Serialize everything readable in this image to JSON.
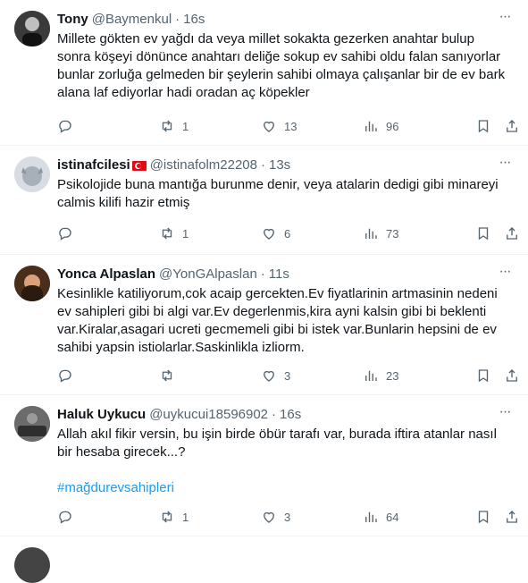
{
  "tweets": [
    {
      "name": "Tony",
      "handle": "@Baymenkul",
      "dot": "·",
      "time": "16s",
      "text": "Millete gökten ev yağdı da veya millet sokakta gezerken anahtar bulup\nsonra köşeyi dönünce anahtarı deliğe sokup ev sahibi oldu falan sanıyorlar\nbunlar zorluğa gelmeden bir şeylerin sahibi olmaya çalışanlar bir de ev bark\nalana laf ediyorlar hadi oradan aç köpekler",
      "hashtag": "",
      "reposts": "1",
      "likes": "13",
      "views": "96"
    },
    {
      "name": "istinafcilesi",
      "handle": "@istinafolm22208",
      "dot": "·",
      "time": "13s",
      "text": "Psikolojide buna mantığa burunme denir, veya atalarin dedigi gibi minareyi\ncalmis kilifi hazir etmiş",
      "hashtag": "",
      "reposts": "1",
      "likes": "6",
      "views": "73"
    },
    {
      "name": "Yonca Alpaslan",
      "handle": "@YonGAlpaslan",
      "dot": "·",
      "time": "11s",
      "text": "Kesinlikle katiliyorum,cok acaip gercekten.Ev fiyatlarinin artmasinin nedeni\nev sahipleri gibi bi algi var.Ev degerlenmis,kira ayni kalsin gibi bi beklenti\nvar.Kiralar,asagari ucreti gecmemeli gibi bi istek var.Bunlarin hepsini de ev\nsahibi yapsin istiolarlar.Saskinlikla izliorm.",
      "hashtag": "",
      "reposts": "",
      "likes": "3",
      "views": "23"
    },
    {
      "name": "Haluk Uykucu",
      "handle": "@uykucui18596902",
      "dot": "·",
      "time": "16s",
      "text": "Allah akıl fikir versin, bu işin birde öbür tarafı var, burada iftira atanlar nasıl\nbir hesaba girecek...?",
      "hashtag": "#mağdurevsahipleri",
      "reposts": "1",
      "likes": "3",
      "views": "64"
    }
  ],
  "more_label": "···",
  "colors": {
    "text": "#0f1419",
    "secondary": "#536471",
    "link": "#1d9bf0",
    "divider": "#eff3f4"
  },
  "icons": [
    "reply-icon",
    "repost-icon",
    "like-icon",
    "views-icon",
    "bookmark-icon",
    "share-icon",
    "more-icon",
    "turkey-flag-icon"
  ]
}
